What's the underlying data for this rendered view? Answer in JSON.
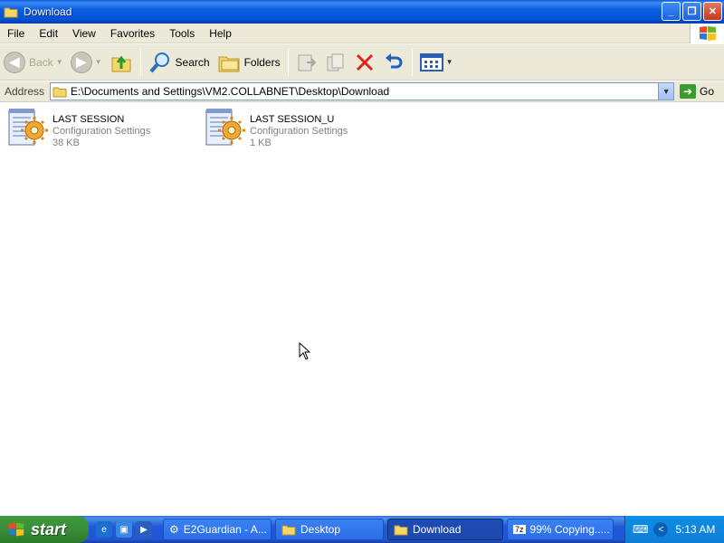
{
  "window": {
    "title": "Download",
    "buttons": {
      "minimize": "_",
      "maximize": "❐",
      "close": "✕"
    }
  },
  "menu": [
    "File",
    "Edit",
    "View",
    "Favorites",
    "Tools",
    "Help"
  ],
  "toolbar": {
    "back_label": "Back",
    "search_label": "Search",
    "folders_label": "Folders"
  },
  "address": {
    "label": "Address",
    "path": "E:\\Documents and Settings\\VM2.COLLABNET\\Desktop\\Download",
    "go_label": "Go"
  },
  "files": [
    {
      "name": "LAST SESSION",
      "type": "Configuration Settings",
      "size": "38 KB"
    },
    {
      "name": "LAST SESSION_U",
      "type": "Configuration Settings",
      "size": "1 KB"
    }
  ],
  "taskbar": {
    "start_label": "start",
    "tasks": [
      {
        "label": "E2Guardian - A...",
        "icon": "e2guardian-icon",
        "active": false
      },
      {
        "label": "Desktop",
        "icon": "folder-icon",
        "active": false
      },
      {
        "label": "Download",
        "icon": "folder-icon",
        "active": true
      },
      {
        "label": "99% Copying.....",
        "icon": "7zip-icon",
        "active": false
      }
    ],
    "tray_arrow": "<",
    "clock": "5:13 AM"
  },
  "colors": {
    "titlebar": "#0a5ee0",
    "chrome": "#ece9d8",
    "taskbar": "#2157d7",
    "start": "#3b8c3b",
    "subtext": "#808080"
  }
}
